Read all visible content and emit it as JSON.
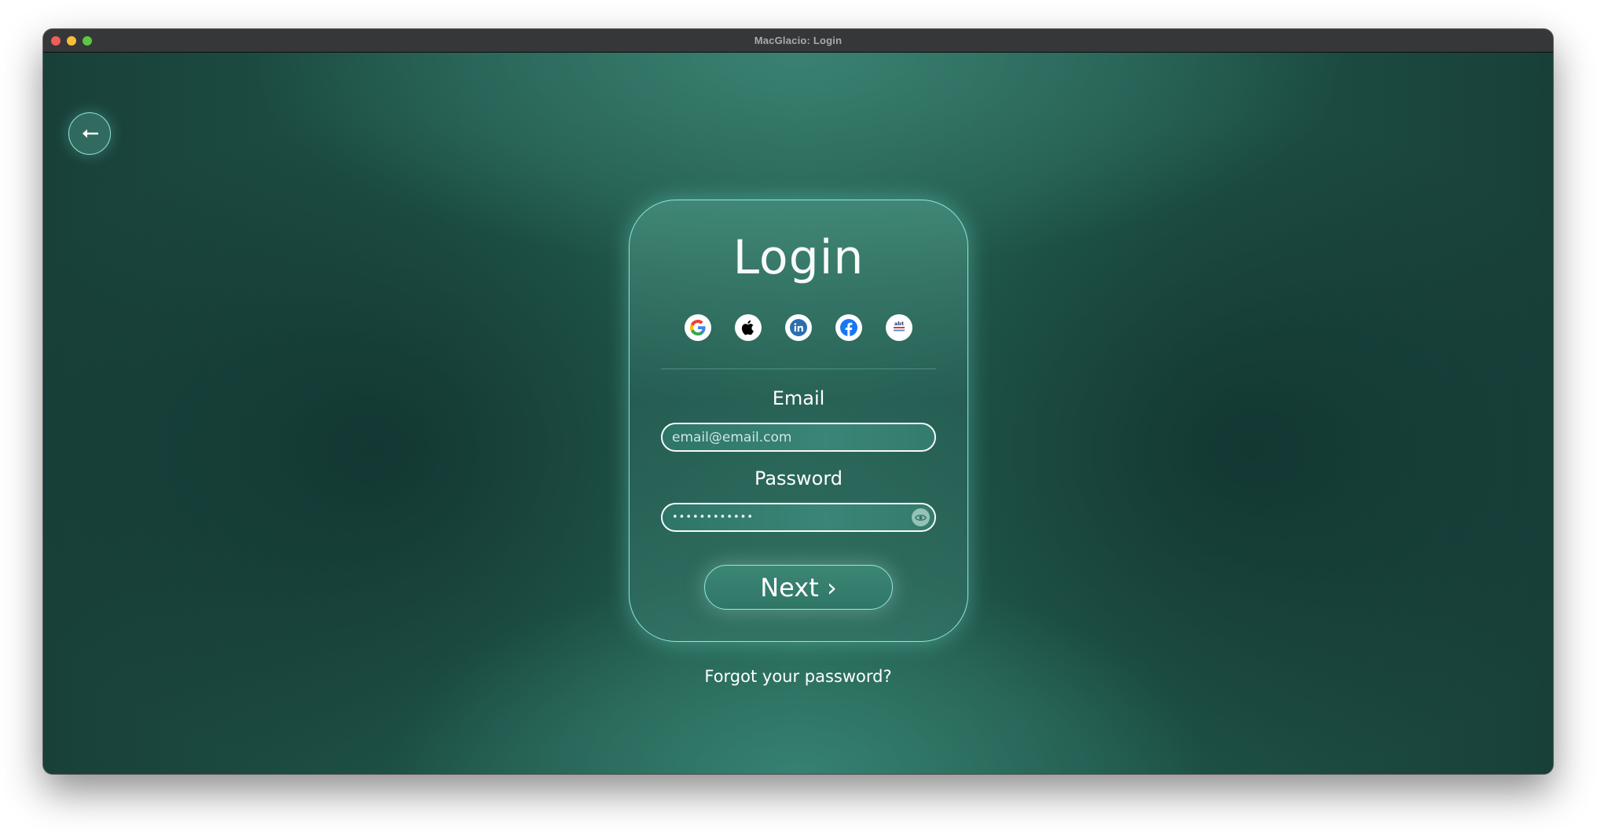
{
  "window": {
    "title": "MacGlacio: Login",
    "controls": [
      "close",
      "minimize",
      "maximize"
    ]
  },
  "back_button": {
    "icon": "arrow-left-icon",
    "glyph": "←"
  },
  "login_card": {
    "title": "Login",
    "social_providers": [
      {
        "name": "Google",
        "icon": "google-icon"
      },
      {
        "name": "Apple",
        "icon": "apple-icon"
      },
      {
        "name": "LinkedIn",
        "icon": "linkedin-icon"
      },
      {
        "name": "Facebook",
        "icon": "facebook-icon"
      },
      {
        "name": "Other provider",
        "icon": "provider-logo-icon"
      }
    ],
    "email": {
      "label": "Email",
      "placeholder": "email@email.com",
      "value": ""
    },
    "password": {
      "label": "Password",
      "value": "••••••••••••",
      "toggle_icon": "eye-icon"
    },
    "next_button": "Next ›"
  },
  "forgot_password": "Forgot your password?",
  "colors": {
    "accent_border": "#8fe9dd",
    "titlebar": "#353738",
    "background_dark": "#173d38"
  }
}
